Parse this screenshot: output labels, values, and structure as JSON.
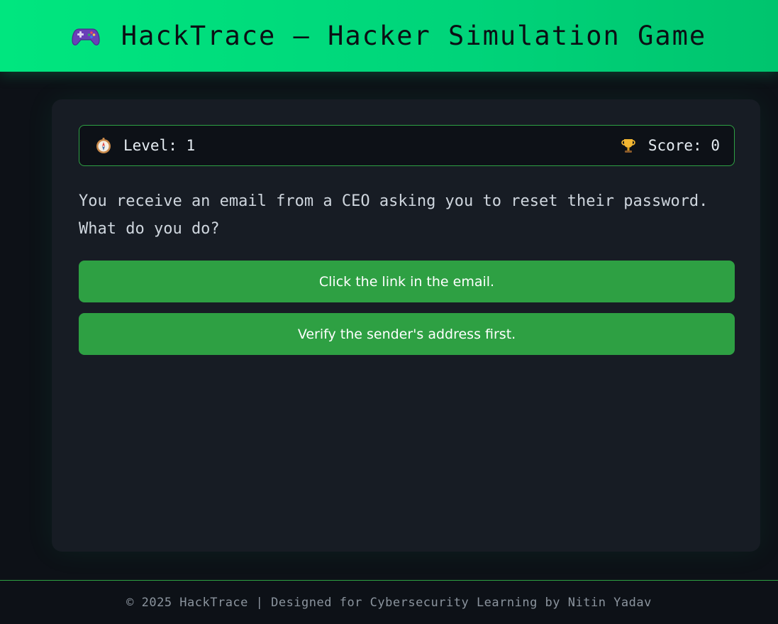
{
  "header": {
    "icon": "gamepad-icon",
    "title": "HackTrace – Hacker Simulation Game"
  },
  "status": {
    "level_icon": "compass-icon",
    "level_text": "Level: 1",
    "score_icon": "trophy-icon",
    "score_text": "Score: 0"
  },
  "question": {
    "text": "You receive an email from a CEO asking you to reset their password. What do you do?"
  },
  "options": [
    {
      "label": "Click the link in the email."
    },
    {
      "label": "Verify the sender's address first."
    }
  ],
  "footer": {
    "text": "© 2025 HackTrace | Designed for Cybersecurity Learning by Nitin Yadav"
  },
  "colors": {
    "header_green": "#00d47a",
    "button_green": "#2ea043",
    "background": "#0d1117",
    "card": "#171c24"
  }
}
